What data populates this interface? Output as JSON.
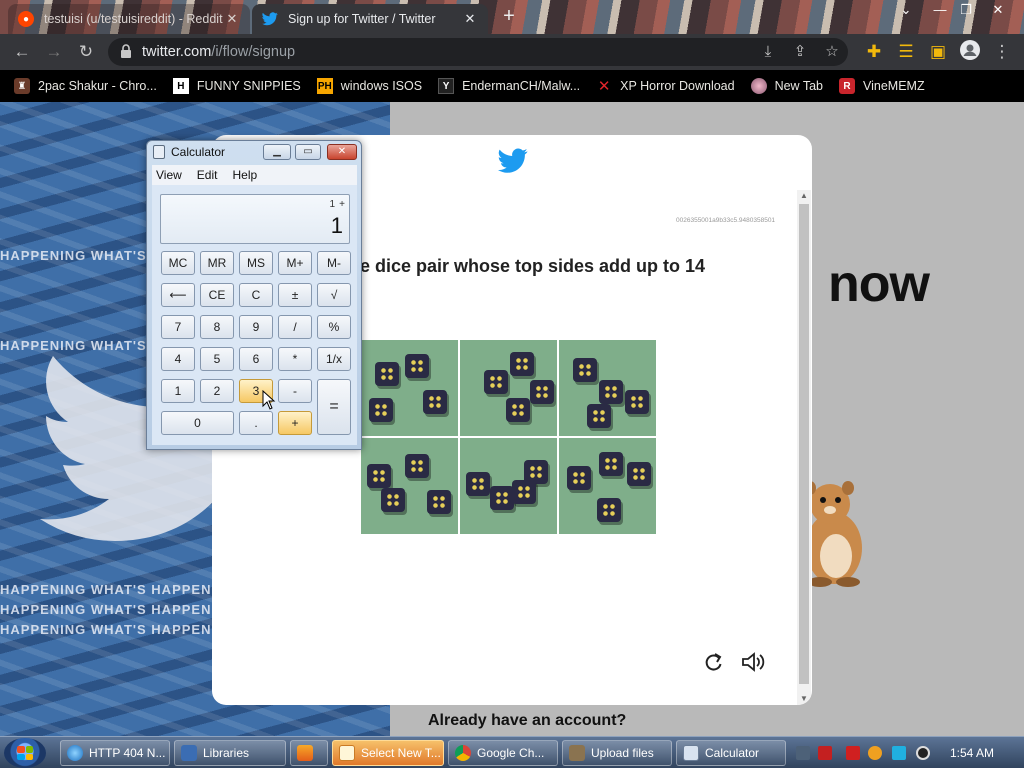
{
  "browser": {
    "tabs": [
      {
        "title": "testuisi (u/testuisireddit) - Reddit",
        "active": false,
        "favicon": "reddit-icon"
      },
      {
        "title": "Sign up for Twitter / Twitter",
        "active": true,
        "favicon": "twitter-icon"
      }
    ],
    "url_host": "twitter.com",
    "url_path": "/i/flow/signup",
    "bookmarks": [
      {
        "label": "2pac Shakur - Chro...",
        "icon": "bookmark-folder-icon"
      },
      {
        "label": "FUNNY SNIPPIES",
        "icon": "h-icon"
      },
      {
        "label": "windows ISOS",
        "icon": "ph-icon"
      },
      {
        "label": "EndermanCH/Malw...",
        "icon": "yp-icon"
      },
      {
        "label": "XP Horror Download",
        "icon": "x-red-icon"
      },
      {
        "label": "New Tab",
        "icon": "globe-icon"
      },
      {
        "label": "VineMEMZ",
        "icon": "r-red-icon"
      }
    ]
  },
  "page": {
    "background_word": "now",
    "background_text": "HAPPENING WHAT'S HAPPEN",
    "challenge": {
      "session_id": "0026355001a9b33c5.9480358501",
      "prompt": "he dice pair whose top sides add up to 14",
      "tiles": 6
    },
    "already_have_account": "Already have an account?"
  },
  "calculator": {
    "title": "Calculator",
    "menu": [
      "View",
      "Edit",
      "Help"
    ],
    "memory_line": "1",
    "operator": "+",
    "display": "1",
    "keys": {
      "mc": "MC",
      "mr": "MR",
      "ms": "MS",
      "mplus": "M+",
      "mminus": "M-",
      "back": "⟵",
      "ce": "CE",
      "c": "C",
      "pm": "±",
      "sqrt": "√",
      "k7": "7",
      "k8": "8",
      "k9": "9",
      "div": "/",
      "pct": "%",
      "k4": "4",
      "k5": "5",
      "k6": "6",
      "mul": "*",
      "inv": "1/x",
      "k1": "1",
      "k2": "2",
      "k3": "3",
      "sub": "-",
      "eq": "=",
      "k0": "0",
      "dot": ".",
      "add": "+"
    }
  },
  "taskbar": {
    "items": [
      {
        "label": "HTTP 404 N...",
        "icon": "ie-icon"
      },
      {
        "label": "Libraries",
        "icon": "explorer-icon"
      },
      {
        "label": "",
        "icon": "media-player-icon"
      },
      {
        "label": "Select New T...",
        "icon": "paint-icon",
        "active": true
      },
      {
        "label": "Google Ch...",
        "icon": "chrome-icon"
      },
      {
        "label": "Upload files",
        "icon": "upload-icon"
      },
      {
        "label": "Calculator",
        "icon": "calculator-icon"
      }
    ],
    "clock": "1:54 AM"
  },
  "colors": {
    "chrome_dark": "#35363a",
    "twitter_blue": "#1d9bf0",
    "calc_hot_key": "#f6c864",
    "dice_felt": "#7fae8a"
  }
}
